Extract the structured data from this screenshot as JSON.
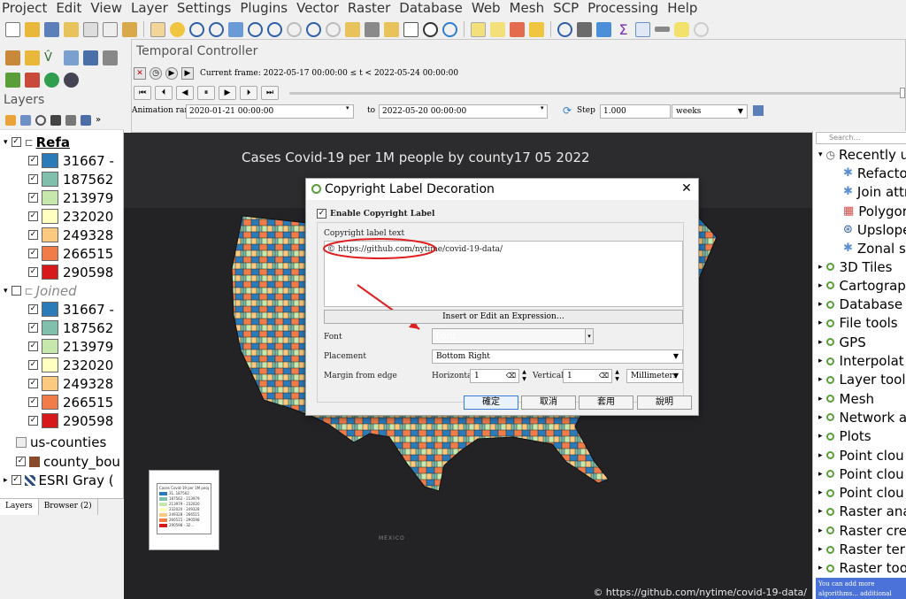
{
  "menu": [
    "Project",
    "Edit",
    "View",
    "Layer",
    "Settings",
    "Plugins",
    "Vector",
    "Raster",
    "Database",
    "Web",
    "Mesh",
    "SCP",
    "Processing",
    "Help"
  ],
  "temporal": {
    "title": "Temporal Controller",
    "current_frame": "Current frame: 2022-05-17 00:00:00 ≤ t < 2022-05-24 00:00:00",
    "animation_range_label": "Animation range",
    "range_start": "2020-01-21 00:00:00",
    "to_label": "to",
    "range_end": "2022-05-20 00:00:00",
    "step_label": "Step",
    "step_value": "1.000",
    "step_unit": "weeks"
  },
  "layers": {
    "title": "Layers",
    "group1_name": "Refa",
    "group2_name": "Joined",
    "classes": [
      "31667 -",
      "187562",
      "213979",
      "232020",
      "249328",
      "266515",
      "290598"
    ],
    "class_colors": [
      "#2b7bb9",
      "#80bfab",
      "#c7e8ad",
      "#ffffbf",
      "#fdc980",
      "#f07c4a",
      "#d7191c"
    ],
    "us_counties": "us-counties",
    "county_bou": "county_bou",
    "esri_gray": "ESRI Gray (",
    "county_color": "#8b4a2b",
    "tabs": [
      "Layers",
      "Browser (2)"
    ]
  },
  "map": {
    "title": "Cases Covid-19 per 1M people by county17 05 2022",
    "copyright": "© https://github.com/nytime/covid-19-data/",
    "mexico": "MEXICO",
    "legend_title": "Cases Covid-19 per 1M people by county",
    "legend_items": [
      "31..187562",
      "187562 - 213979",
      "213979 - 232020",
      "232020 - 249328",
      "249328 - 266515",
      "266515 - 290598",
      "290598 - 32..."
    ]
  },
  "processing": {
    "search_placeholder": "Search…",
    "recently": "Recently u",
    "recent_items": [
      "Refacto",
      "Join attr",
      "Polygor",
      "Upslope",
      "Zonal st"
    ],
    "groups": [
      "3D Tiles",
      "Cartograp",
      "Database",
      "File tools",
      "GPS",
      "Interpolat",
      "Layer tool",
      "Mesh",
      "Network a",
      "Plots",
      "Point clou",
      "Point clou",
      "Point clou",
      "Raster ana",
      "Raster cre",
      "Raster ter",
      "Raster too"
    ],
    "info": "You can add more algorithms... additional providers [close]"
  },
  "dialog": {
    "title": "Copyright Label Decoration",
    "enable_label": "Enable Copyright Label",
    "text_label": "Copyright label text",
    "text_value": "© https://github.com/nytime/covid-19-data/",
    "expression_button": "Insert or Edit an Expression…",
    "font_label": "Font",
    "font_value": "Font",
    "placement_label": "Placement",
    "placement_value": "Bottom Right",
    "margin_label": "Margin from edge",
    "horizontal_label": "Horizontal",
    "horizontal_value": "1",
    "vertical_label": "Vertical",
    "vertical_value": "1",
    "units_value": "Millimeters",
    "buttons": [
      "確定",
      "取消",
      "套用",
      "說明"
    ]
  },
  "colors": {
    "annotation_red": "#e02020",
    "map_bg": "#232326"
  }
}
